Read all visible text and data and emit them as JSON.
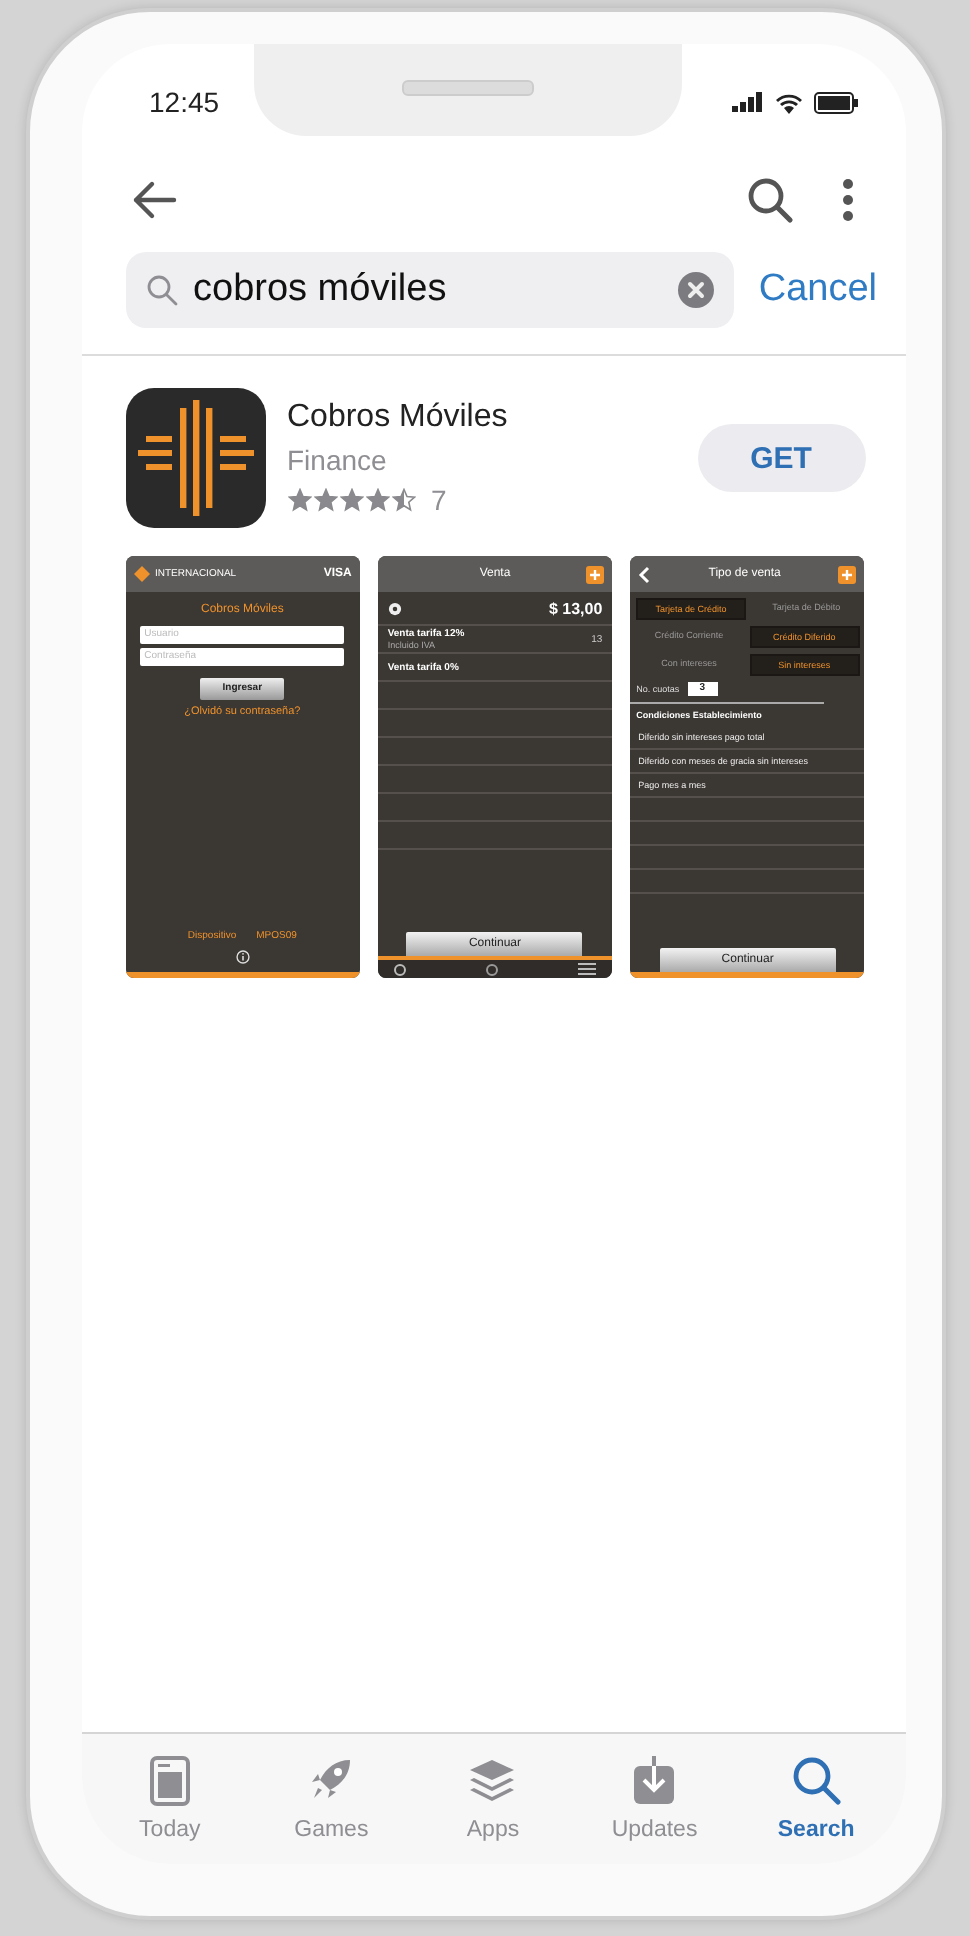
{
  "status_bar": {
    "time": "12:45"
  },
  "search": {
    "value": "cobros móviles",
    "cancel": "Cancel"
  },
  "app": {
    "name": "Cobros Móviles",
    "category": "Finance",
    "stars": 4.5,
    "rating_count": "7",
    "button": "GET"
  },
  "screenshots": [
    {
      "kind": "login",
      "brand": "INTERNACIONAL",
      "card": "VISA",
      "title": "Cobros Móviles",
      "fields": [
        "Usuario",
        "Contraseña"
      ],
      "button": "Ingresar",
      "link": "¿Olvidó su contraseña?",
      "footer": [
        "Dispositivo",
        "MPOS09"
      ]
    },
    {
      "kind": "sale",
      "title": "Venta",
      "amount": "$ 13,00",
      "rows": [
        {
          "label": "Venta tarifa 12%",
          "note": "Incluido IVA",
          "value": "13"
        },
        {
          "label": "Venta tarifa 0%"
        }
      ],
      "button": "Continuar"
    },
    {
      "kind": "sale_type",
      "title": "Tipo de venta",
      "options": [
        [
          {
            "label": "Tarjeta de Crédito",
            "selected": true
          },
          {
            "label": "Tarjeta de Débito",
            "selected": false
          }
        ],
        [
          {
            "label": "Crédito Corriente",
            "selected": false
          },
          {
            "label": "Crédito Diferido",
            "selected": true
          }
        ],
        [
          {
            "label": "Con intereses",
            "selected": false
          },
          {
            "label": "Sin intereses",
            "selected": true
          }
        ]
      ],
      "installments_label": "No. cuotas",
      "installments": "3",
      "section": "Condiciones Establecimiento",
      "rows": [
        "Diferido sin intereses pago total",
        "Diferido con meses de gracia sin intereses",
        "Pago mes a mes"
      ],
      "button": "Continuar"
    }
  ],
  "tab_bar": [
    {
      "label": "Today",
      "selected": false
    },
    {
      "label": "Games",
      "selected": false
    },
    {
      "label": "Apps",
      "selected": false
    },
    {
      "label": "Updates",
      "selected": false
    },
    {
      "label": "Search",
      "selected": true
    }
  ]
}
